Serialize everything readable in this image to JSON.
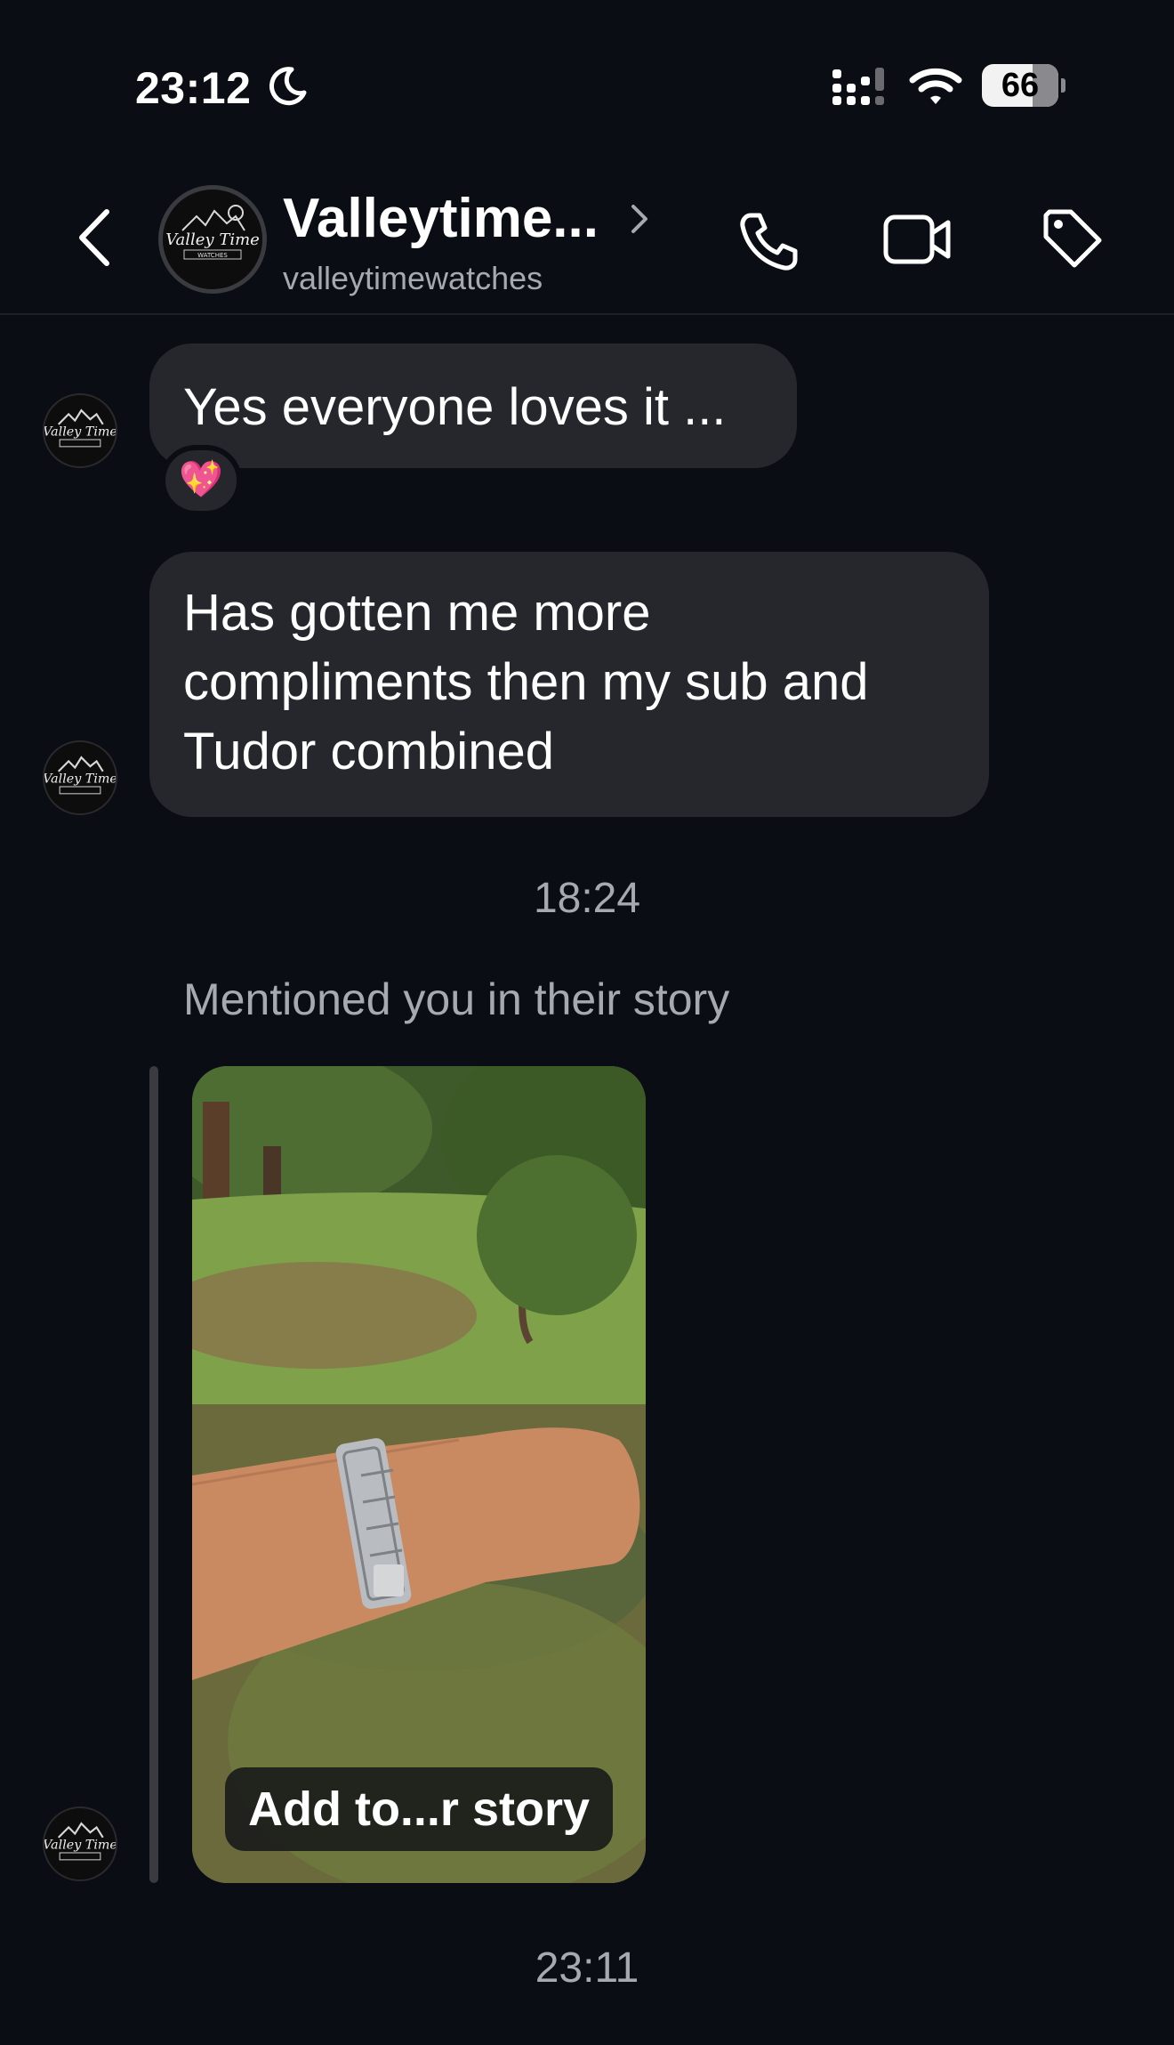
{
  "status_bar": {
    "time": "23:12",
    "battery": "66",
    "battery_level": 0.66,
    "icons": [
      "moon-icon",
      "signal-icon",
      "wifi-icon",
      "battery-icon"
    ]
  },
  "header": {
    "title": "Valleytime...",
    "subtitle": "valleytimewatches",
    "icons": [
      "back-chevron-icon",
      "chevron-right-icon",
      "phone-icon",
      "video-camera-icon",
      "tag-icon"
    ]
  },
  "messages": [
    {
      "text": "Yes everyone loves it ...",
      "reaction": "💖"
    },
    {
      "text_lines": [
        "Has gotten me more",
        "compliments then my sub and",
        "Tudor combined"
      ]
    }
  ],
  "timestamps": [
    "18:24",
    "23:11"
  ],
  "story": {
    "mention_text": "Mentioned you in their story",
    "add_button_label": "Add to...r story"
  },
  "colors": {
    "background": "#0b0d14",
    "bubble": "#26272c",
    "secondary_text": "#a7a9b0"
  }
}
